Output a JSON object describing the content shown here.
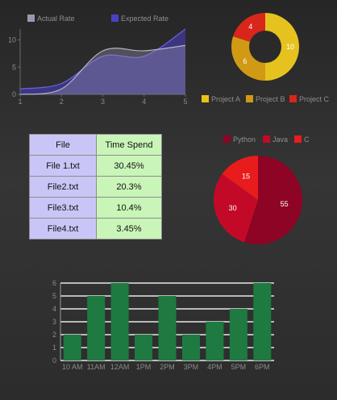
{
  "chart_data": [
    {
      "type": "area",
      "x": [
        1,
        2,
        3,
        4,
        5
      ],
      "series": [
        {
          "name": "Actual Rate",
          "color": "#9a98b0",
          "values": [
            0,
            1,
            8,
            8,
            9
          ]
        },
        {
          "name": "Expected Rate",
          "color": "#4a40c8",
          "values": [
            1,
            2,
            7,
            7,
            12
          ]
        }
      ],
      "xlim": [
        1,
        5
      ],
      "ylim": [
        0,
        12
      ],
      "x_ticks": [
        "1",
        "2",
        "3",
        "4",
        "5"
      ],
      "y_ticks": [
        "0",
        "5",
        "10"
      ],
      "legend": "top"
    },
    {
      "type": "pie",
      "style": "donut",
      "slices": [
        {
          "label": "Project A",
          "value": 10,
          "color": "#e6c21f"
        },
        {
          "label": "Project B",
          "value": 6,
          "color": "#d19a14"
        },
        {
          "label": "Project C",
          "value": 4,
          "color": "#d8261a"
        }
      ],
      "legend": "bottom"
    },
    {
      "type": "table",
      "columns": [
        "File",
        "Time Spend"
      ],
      "rows": [
        [
          "File 1.txt",
          "30.45%"
        ],
        [
          "File2.txt",
          "20.3%"
        ],
        [
          "File3.txt",
          "10.4%"
        ],
        [
          "File4.txt",
          "3.45%"
        ]
      ]
    },
    {
      "type": "pie",
      "slices": [
        {
          "label": "Python",
          "value": 55,
          "color": "#8e0424"
        },
        {
          "label": "Java",
          "value": 30,
          "color": "#c20a28"
        },
        {
          "label": "C",
          "value": 15,
          "color": "#e81c1c"
        }
      ],
      "legend": "top"
    },
    {
      "type": "bar",
      "categories": [
        "10 AM",
        "11AM",
        "12AM",
        "1PM",
        "2PM",
        "3PM",
        "4PM",
        "5PM",
        "6PM"
      ],
      "values": [
        2,
        5,
        6,
        2,
        5,
        2,
        3,
        4,
        6
      ],
      "color": "#1e7a40",
      "ylim": [
        0,
        6
      ],
      "y_ticks": [
        "0",
        "1",
        "2",
        "3",
        "4",
        "5",
        "6"
      ],
      "grid": true
    }
  ]
}
